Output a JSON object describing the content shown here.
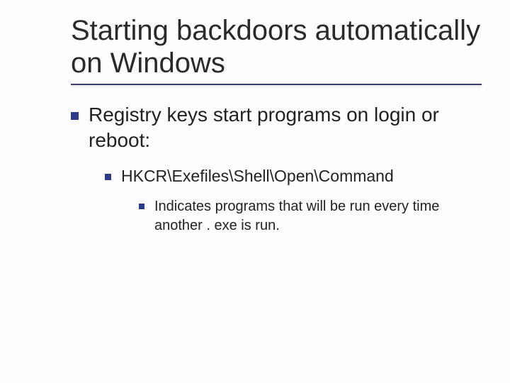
{
  "slide": {
    "title": "Starting backdoors automatically on Windows",
    "bullets": {
      "l1": "Registry keys start programs on login or reboot:",
      "l2": "HKCR\\Exefiles\\Shell\\Open\\Command",
      "l3": "Indicates programs that will be run every time another . exe is run."
    }
  }
}
